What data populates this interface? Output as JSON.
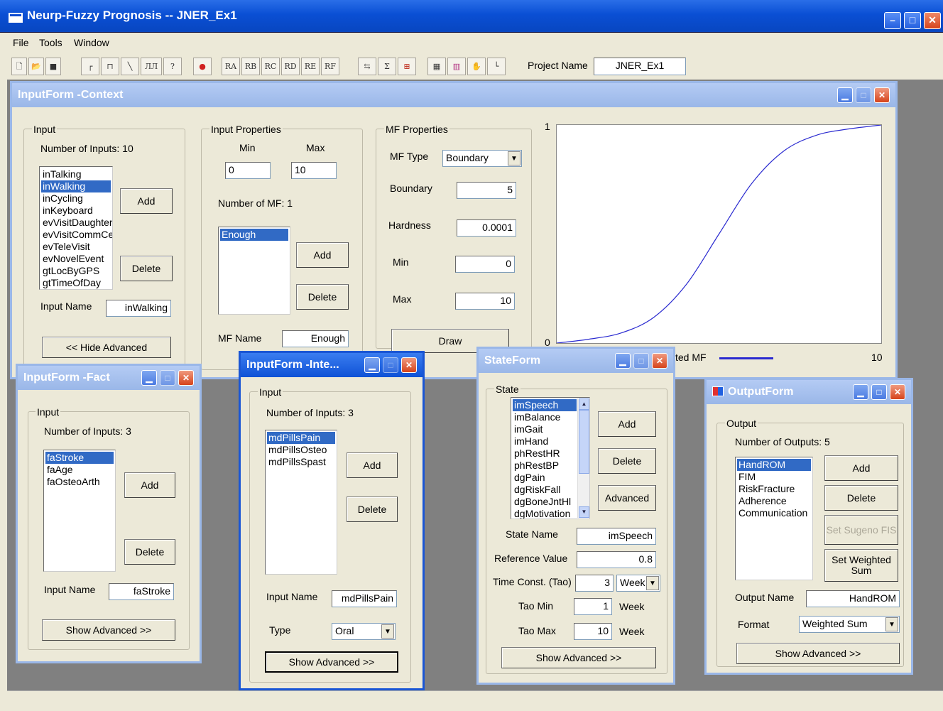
{
  "app": {
    "title": "Neurp-Fuzzy Prognosis -- JNER_Ex1"
  },
  "menu": [
    "File",
    "Tools",
    "Window"
  ],
  "toolbar": {
    "icons": [
      "new-icon",
      "open-icon",
      "save-icon",
      "mf-step-icon",
      "mf-pulse-icon",
      "mf-ramp-icon",
      "mf-multi-icon",
      "help-icon",
      "target-icon",
      "ra-icon",
      "rb-icon",
      "rc-icon",
      "rd-icon",
      "re-icon",
      "rf-icon",
      "connect-icon",
      "sum-icon",
      "network-icon",
      "run-icon",
      "chart-icon",
      "hand-icon",
      "axis-icon"
    ],
    "rule_labels": [
      "RA",
      "RB",
      "RC",
      "RD",
      "RE",
      "RF"
    ],
    "misc": [
      "?",
      "Σ"
    ],
    "project_label": "Project Name",
    "project_value": "JNER_Ex1"
  },
  "context": {
    "title": "InputForm -Context",
    "input_legend": "Input",
    "num_inputs": "Number of Inputs: 10",
    "inputs": [
      "inTalking",
      "inWalking",
      "inCycling",
      "inKeyboard",
      "evVisitDaughter",
      "evVisitCommCe",
      "evTeleVisit",
      "evNovelEvent",
      "gtLocByGPS",
      "gtTimeOfDay"
    ],
    "selected_input": 1,
    "add": "Add",
    "delete": "Delete",
    "input_name_label": "Input Name",
    "input_name": "inWalking",
    "hide_adv": "<< Hide Advanced",
    "props_legend": "Input Properties",
    "min_label": "Min",
    "max_label": "Max",
    "min": "0",
    "max": "10",
    "num_mf": "Number of MF: 1",
    "mfs": [
      "Enough"
    ],
    "mf_name_label": "MF Name",
    "mf_name": "Enough",
    "mfprops_legend": "MF Properties",
    "mf_type_label": "MF Type",
    "mf_type": "Boundary",
    "boundary_label": "Boundary",
    "boundary": "5",
    "hardness_label": "Hardness",
    "hardness": "0.0001",
    "mfmin_label": "Min",
    "mfmin": "0",
    "mfmax_label": "Max",
    "mfmax": "10",
    "draw": "Draw",
    "plot_y1": "1",
    "plot_y0": "0",
    "plot_x10": "10",
    "legend_text": "ted MF"
  },
  "chart_data": {
    "type": "line",
    "x": [
      0,
      1,
      2,
      3,
      4,
      5,
      6,
      7,
      8,
      9,
      10
    ],
    "series": [
      {
        "values": [
          0.0,
          0.018,
          0.047,
          0.119,
          0.27,
          0.5,
          0.73,
          0.881,
          0.953,
          0.982,
          1.0
        ]
      }
    ],
    "xlim": [
      0,
      10
    ],
    "ylim": [
      0,
      1
    ],
    "legend_label": "ted MF",
    "colors": {
      "line": "#2a2ad0"
    }
  },
  "fact": {
    "title": "InputForm -Fact",
    "input_legend": "Input",
    "num_inputs": "Number of Inputs: 3",
    "inputs": [
      "faStroke",
      "faAge",
      "faOsteoArth"
    ],
    "selected_input": 0,
    "add": "Add",
    "delete": "Delete",
    "input_name_label": "Input Name",
    "input_name": "faStroke",
    "show_adv": "Show Advanced >>"
  },
  "inte": {
    "title": "InputForm -Inte...",
    "input_legend": "Input",
    "num_inputs": "Number of Inputs: 3",
    "inputs": [
      "mdPillsPain",
      "mdPillsOsteo",
      "mdPillsSpast"
    ],
    "selected_input": 0,
    "add": "Add",
    "delete": "Delete",
    "input_name_label": "Input Name",
    "input_name": "mdPillsPain",
    "type_label": "Type",
    "type": "Oral",
    "show_adv": "Show Advanced >>"
  },
  "state": {
    "title": "StateForm",
    "legend": "State",
    "states": [
      "imSpeech",
      "imBalance",
      "imGait",
      "imHand",
      "phRestHR",
      "phRestBP",
      "dgPain",
      "dgRiskFall",
      "dgBoneJntHl",
      "dgMotivation"
    ],
    "selected_state": 0,
    "add": "Add",
    "delete": "Delete",
    "advanced": "Advanced",
    "state_name_label": "State Name",
    "state_name": "imSpeech",
    "ref_label": "Reference Value",
    "ref": "0.8",
    "tc_label": "Time Const. (Tao)",
    "tc": "3",
    "tc_unit": "Week",
    "taomin_label": "Tao Min",
    "taomin": "1",
    "taomax_label": "Tao Max",
    "taomax": "10",
    "week": "Week",
    "show_adv": "Show Advanced >>"
  },
  "output": {
    "title": "OutputForm",
    "legend": "Output",
    "num_outputs": "Number of Outputs: 5",
    "outputs": [
      "HandROM",
      "FIM",
      "RiskFracture",
      "Adherence",
      "Communication"
    ],
    "selected_output": 0,
    "add": "Add",
    "delete": "Delete",
    "set_sugeno": "Set Sugeno FIS",
    "set_weighted": "Set Weighted Sum",
    "output_name_label": "Output Name",
    "output_name": "HandROM",
    "format_label": "Format",
    "format": "Weighted Sum",
    "show_adv": "Show Advanced >>"
  },
  "colors": {
    "title_active": "#0f52d6",
    "title_inactive": "#9ab7e8",
    "selection": "#316ac5"
  }
}
